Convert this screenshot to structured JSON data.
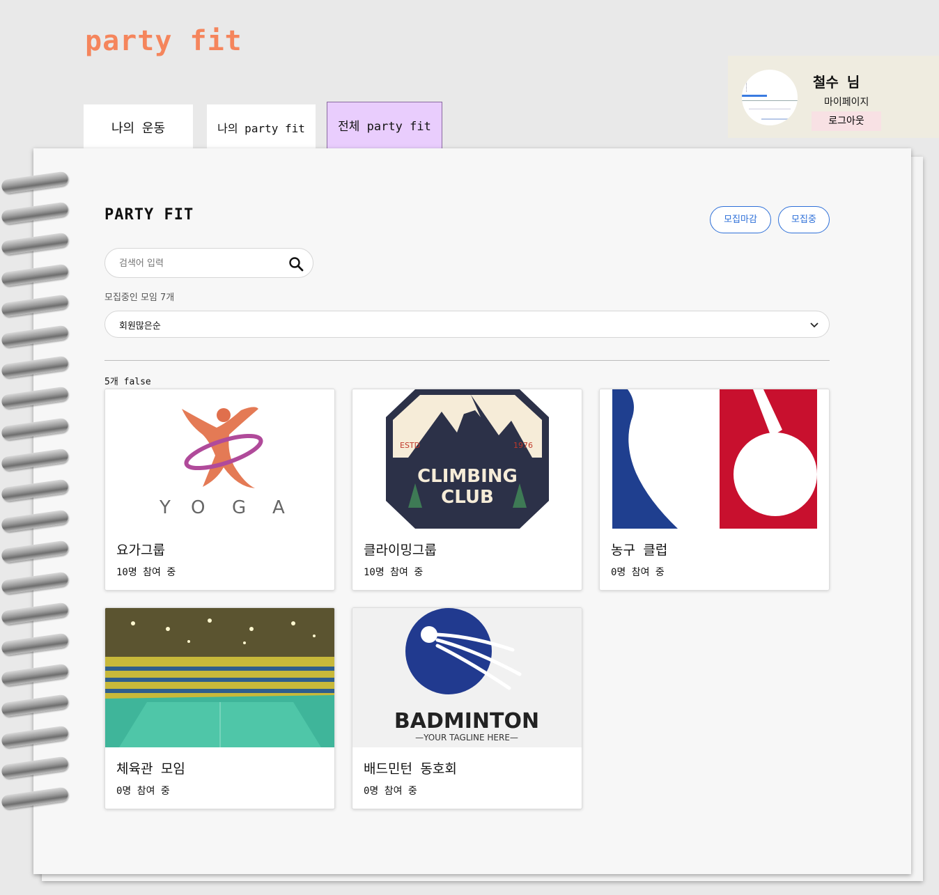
{
  "app": {
    "logo": "party fit"
  },
  "user": {
    "name": "철수 님",
    "mypage": "마이페이지",
    "logout": "로그아웃"
  },
  "tabs": [
    {
      "label": "나의 운동"
    },
    {
      "label": "나의 party fit"
    },
    {
      "label": "전체 party fit"
    }
  ],
  "main": {
    "title": "PARTY FIT",
    "filter_closed": "모집마감",
    "filter_open": "모집중",
    "search_placeholder": "검색어 입력",
    "count_text": "모집중인 모임 7개",
    "sort_value": "회원많은순",
    "result_label": "5개 false"
  },
  "cards": [
    {
      "title": "요가그룹",
      "meta": "10명 참여 중",
      "image_text": [
        "Y",
        "O",
        "G",
        "A"
      ]
    },
    {
      "title": "클라이밍그룹",
      "meta": "10명 참여 중",
      "image_text": [
        "ESTD",
        "1976",
        "CLIMBING",
        "CLUB"
      ]
    },
    {
      "title": "농구 클럽",
      "meta": "0명 참여 중"
    },
    {
      "title": "체육관 모임",
      "meta": "0명 참여 중"
    },
    {
      "title": "배드민턴 동호회",
      "meta": "0명 참여 중",
      "image_text": [
        "BADMINTON",
        "—YOUR TAGLINE HERE—"
      ]
    }
  ],
  "colors": {
    "logo": "#f5855c",
    "active_tab": "#e9cdfd",
    "accent_blue": "#2d6fd8",
    "logout_bg": "#f8e1e4"
  }
}
